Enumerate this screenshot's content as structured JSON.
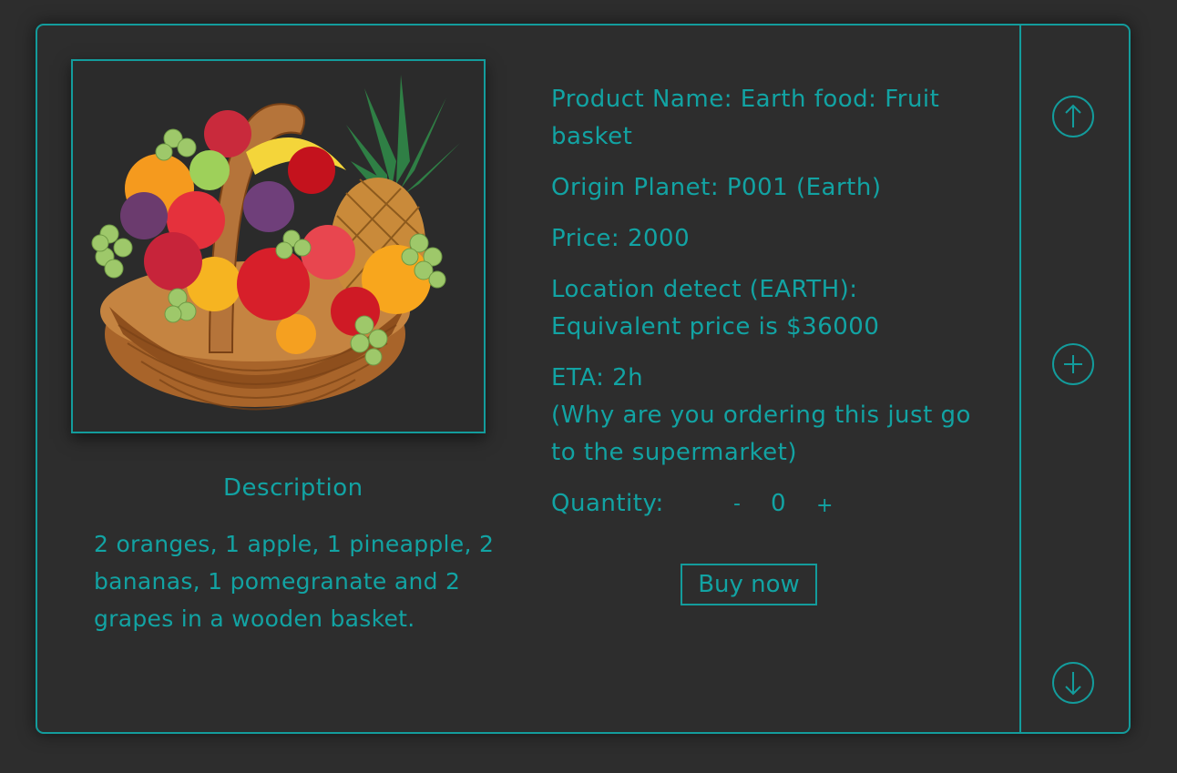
{
  "product": {
    "name_label": "Product Name: Earth food: Fruit basket",
    "origin_label": "Origin Planet: P001 (Earth)",
    "price_label": "Price: 2000",
    "location_label": "Location detect (EARTH): Equivalent price is $36000",
    "eta_label": "ETA: 2h",
    "eta_note": "(Why are you ordering this just go to the supermarket)",
    "image_alt": "Fruit basket"
  },
  "description": {
    "title": "Description",
    "text": "2 oranges, 1 apple, 1 pineapple, 2 bananas, 1 pomegranate and 2 grapes in a wooden basket."
  },
  "quantity": {
    "label": "Quantity:",
    "minus": "-",
    "value": "0",
    "plus": "+"
  },
  "actions": {
    "buy_label": "Buy now"
  },
  "nav": {
    "up_icon": "arrow-up-icon",
    "add_icon": "plus-icon",
    "down_icon": "arrow-down-icon"
  },
  "colors": {
    "accent": "#139c9c",
    "text": "#12a3a3",
    "background": "#2d2d2d"
  }
}
